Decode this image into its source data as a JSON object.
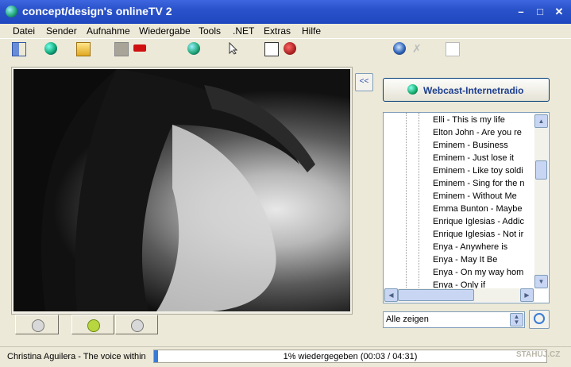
{
  "window": {
    "title": "concept/design's onlineTV 2"
  },
  "menu": [
    {
      "label": "Datei"
    },
    {
      "label": "Sender"
    },
    {
      "label": "Aufnahme"
    },
    {
      "label": "Wiedergabe"
    },
    {
      "label": "Tools"
    },
    {
      "label": ".NET"
    },
    {
      "label": "Extras"
    },
    {
      "label": "Hilfe"
    }
  ],
  "toolbar": {
    "icons": [
      "exit-icon",
      "globe-icon",
      "folder-icon",
      "stop-record-icon",
      "record-icon",
      "channel-globe-icon",
      "cursor-icon",
      "screenshot-icon",
      "settings-icon",
      "webcam-icon",
      "mute-mic-icon",
      "page-icon"
    ]
  },
  "panel": {
    "collapse_label": "<<",
    "webcast_label": "Webcast-Internetradio",
    "list": [
      {
        "label": "Elli - This is my life"
      },
      {
        "label": "Elton John - Are you re"
      },
      {
        "label": "Eminem - Business"
      },
      {
        "label": "Eminem - Just lose it"
      },
      {
        "label": "Eminem - Like toy soldi"
      },
      {
        "label": "Eminem - Sing for the n"
      },
      {
        "label": "Eminem - Without Me"
      },
      {
        "label": "Emma Bunton - Maybe"
      },
      {
        "label": "Enrique Iglesias - Addic"
      },
      {
        "label": "Enrique Iglesias - Not ir"
      },
      {
        "label": "Enya - Anywhere is"
      },
      {
        "label": "Enya - May It Be"
      },
      {
        "label": "Enya - On my way hom"
      },
      {
        "label": "Enya - Only if"
      }
    ],
    "filter_value": "Alle zeigen"
  },
  "status": {
    "track": "Christina Aguilera - The voice within",
    "progress_text": "1% wiedergegeben  (00:03 / 04:31)",
    "progress_percent": 1
  },
  "watermark": "STAHUJ.CZ"
}
